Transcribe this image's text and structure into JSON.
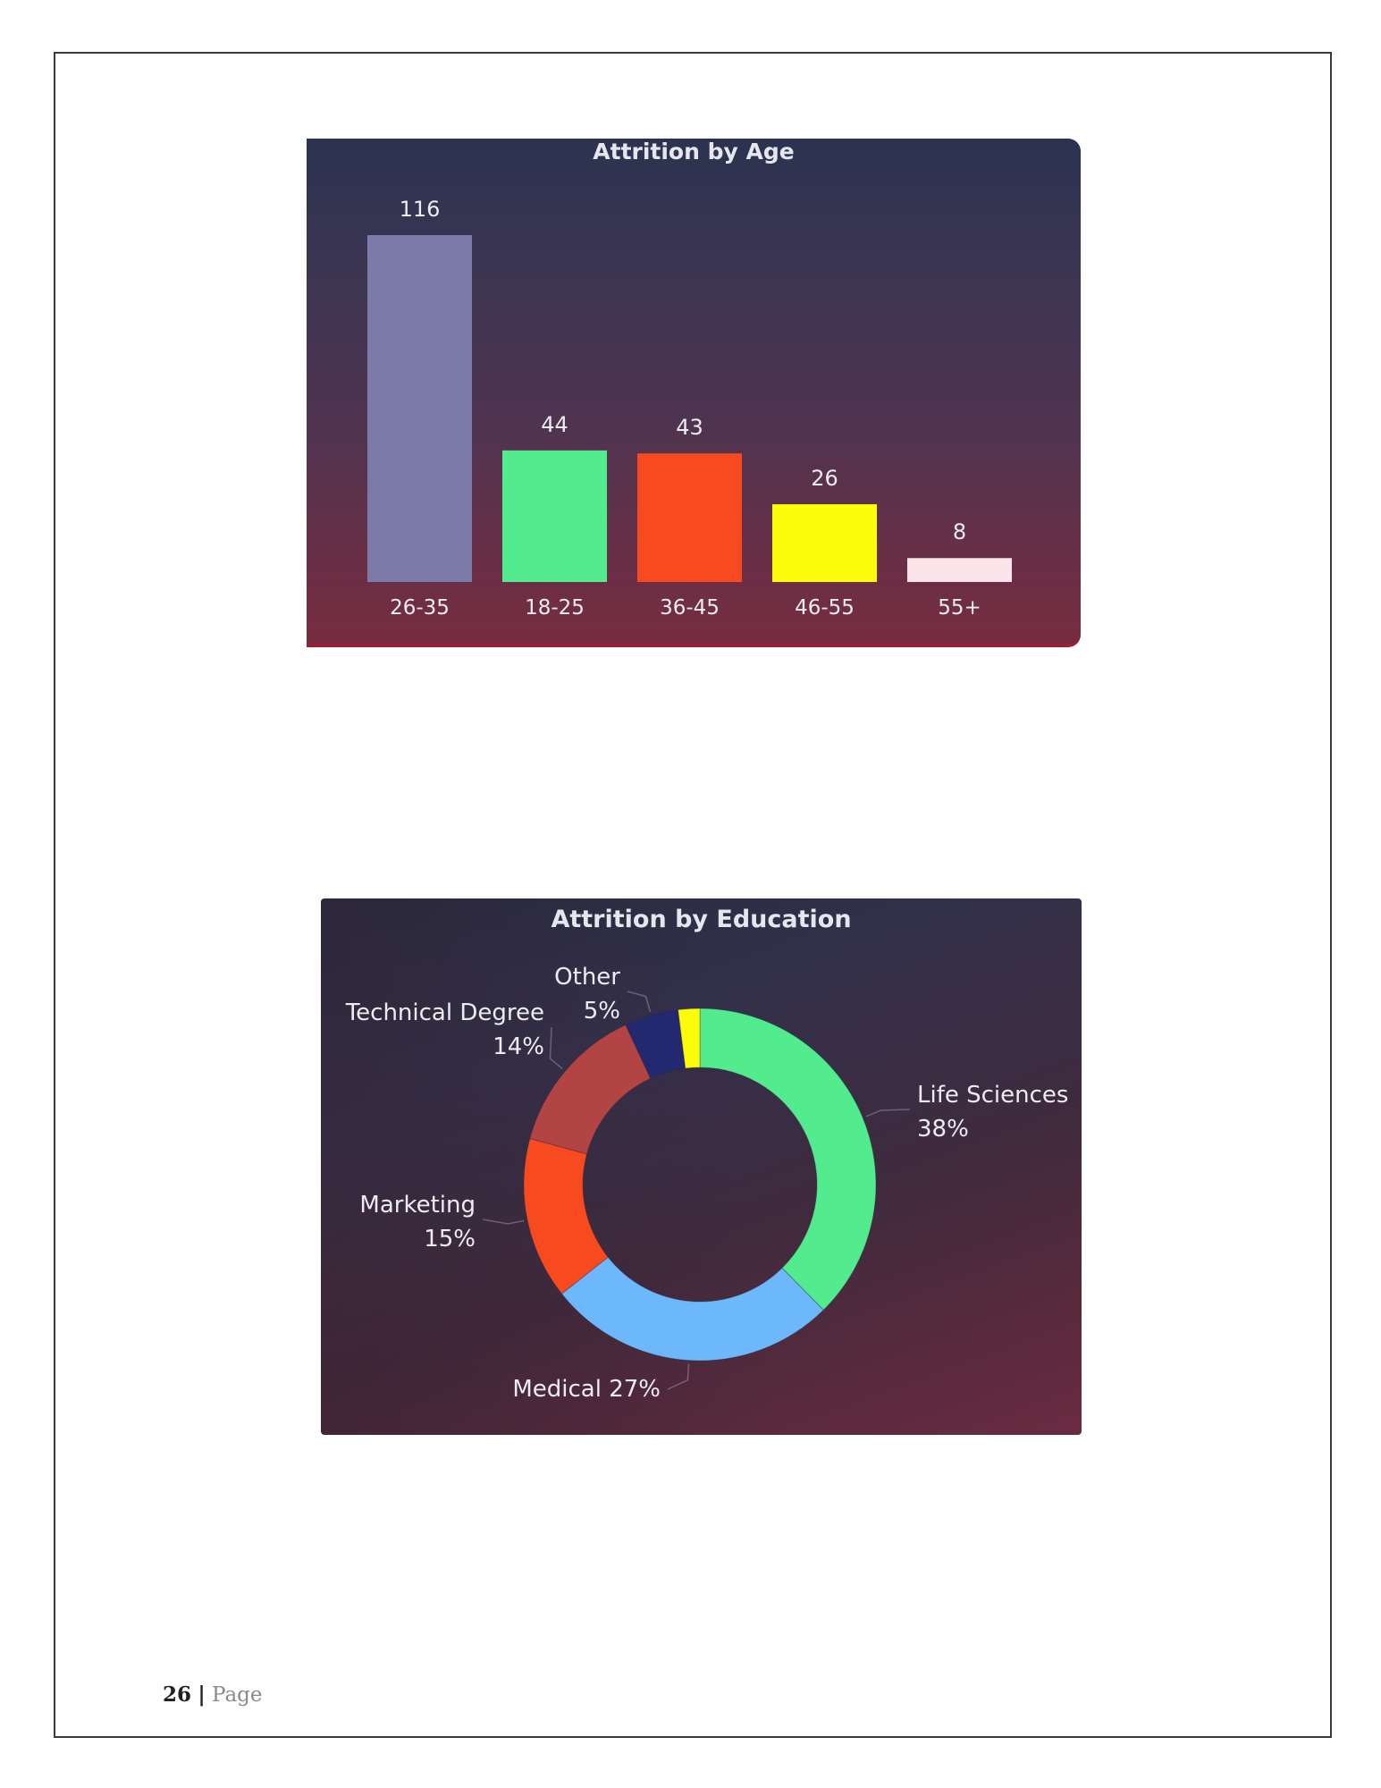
{
  "charts": {
    "age": {
      "title": "Attrition by Age"
    },
    "education": {
      "title": "Attrition by Education"
    }
  },
  "chart_data": [
    {
      "type": "bar",
      "title": "Attrition by Age",
      "xlabel": "",
      "ylabel": "",
      "categories": [
        "26-35",
        "18-25",
        "36-45",
        "46-55",
        "55+"
      ],
      "values": [
        116,
        44,
        43,
        26,
        8
      ],
      "colors": [
        "#7b7aa8",
        "#52eb8e",
        "#f84a1f",
        "#fbfb0a",
        "#fde3ea"
      ],
      "ylim": [
        0,
        116
      ],
      "grid": false,
      "data_labels": true
    },
    {
      "type": "pie",
      "donut": true,
      "title": "Attrition by Education",
      "categories": [
        "Life Sciences",
        "Medical",
        "Marketing",
        "Technical Degree",
        "Other",
        ""
      ],
      "values": [
        38,
        27,
        15,
        14,
        5,
        2
      ],
      "labels": [
        "Life Sciences 38%",
        "Medical 27%",
        "Marketing 15%",
        "Technical Degree 14%",
        "Other 5%",
        ""
      ],
      "label_parts": [
        [
          "Life Sciences",
          "38%"
        ],
        [
          "Medical 27%"
        ],
        [
          "Marketing",
          "15%"
        ],
        [
          "Technical Degree",
          "14%"
        ],
        [
          "Other",
          "5%"
        ],
        []
      ],
      "colors": [
        "#52eb8e",
        "#6cb8fb",
        "#f84a1f",
        "#b24444",
        "#23296e",
        "#fbfb0a"
      ]
    }
  ],
  "footer": {
    "page_number": "26",
    "separator": "|",
    "page_label": "Page"
  }
}
